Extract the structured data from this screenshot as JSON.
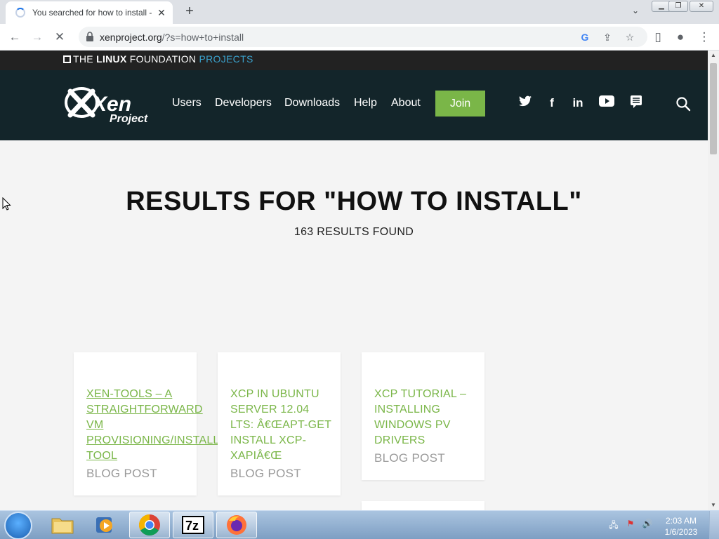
{
  "browser": {
    "tab_title": "You searched for how to install -",
    "url_host": "xenproject.org",
    "url_path": "/?s=how+to+install"
  },
  "site": {
    "lf_logo": {
      "the": "THE ",
      "linux": "LINUX",
      "foundation": " FOUNDATION ",
      "projects": "PROJECTS"
    },
    "logo": {
      "xen": "Xen",
      "project": "Project"
    },
    "nav": [
      {
        "label": "Users"
      },
      {
        "label": "Developers"
      },
      {
        "label": "Downloads"
      },
      {
        "label": "Help"
      },
      {
        "label": "About"
      }
    ],
    "join_label": "Join",
    "social": [
      {
        "icon": "twitter-icon",
        "glyph": "🐦"
      },
      {
        "icon": "facebook-icon",
        "glyph": "f"
      },
      {
        "icon": "linkedin-icon",
        "glyph": "in"
      },
      {
        "icon": "youtube-icon",
        "glyph": "▶"
      },
      {
        "icon": "chat-icon",
        "glyph": "≡"
      }
    ],
    "colors": {
      "brand_green": "#7ab648",
      "nav_bg": "#13252a",
      "lf_blue": "#3aa1cc"
    }
  },
  "results": {
    "title": "RESULTS FOR \"HOW TO INSTALL\"",
    "count": "163 RESULTS FOUND",
    "cards": [
      {
        "title": "XEN-TOOLS – A STRAIGHTFORWARD VM PROVISIONING/INSTALL TOOL",
        "type": "BLOG POST"
      },
      {
        "title": "XCP IN UBUNTU SERVER 12.04 LTS: â€œAPT-GET INSTALL XCP-XAPIâ€Œ",
        "type": "BLOG POST"
      },
      {
        "title": "XCP TUTORIAL – INSTALLING WINDOWS PV DRIVERS",
        "type": "BLOG POST"
      }
    ]
  },
  "taskbar": {
    "apps": [
      "explorer",
      "media-player",
      "chrome",
      "7zip",
      "firefox"
    ],
    "clock_time": "2:03 AM",
    "clock_date": "1/6/2023"
  }
}
